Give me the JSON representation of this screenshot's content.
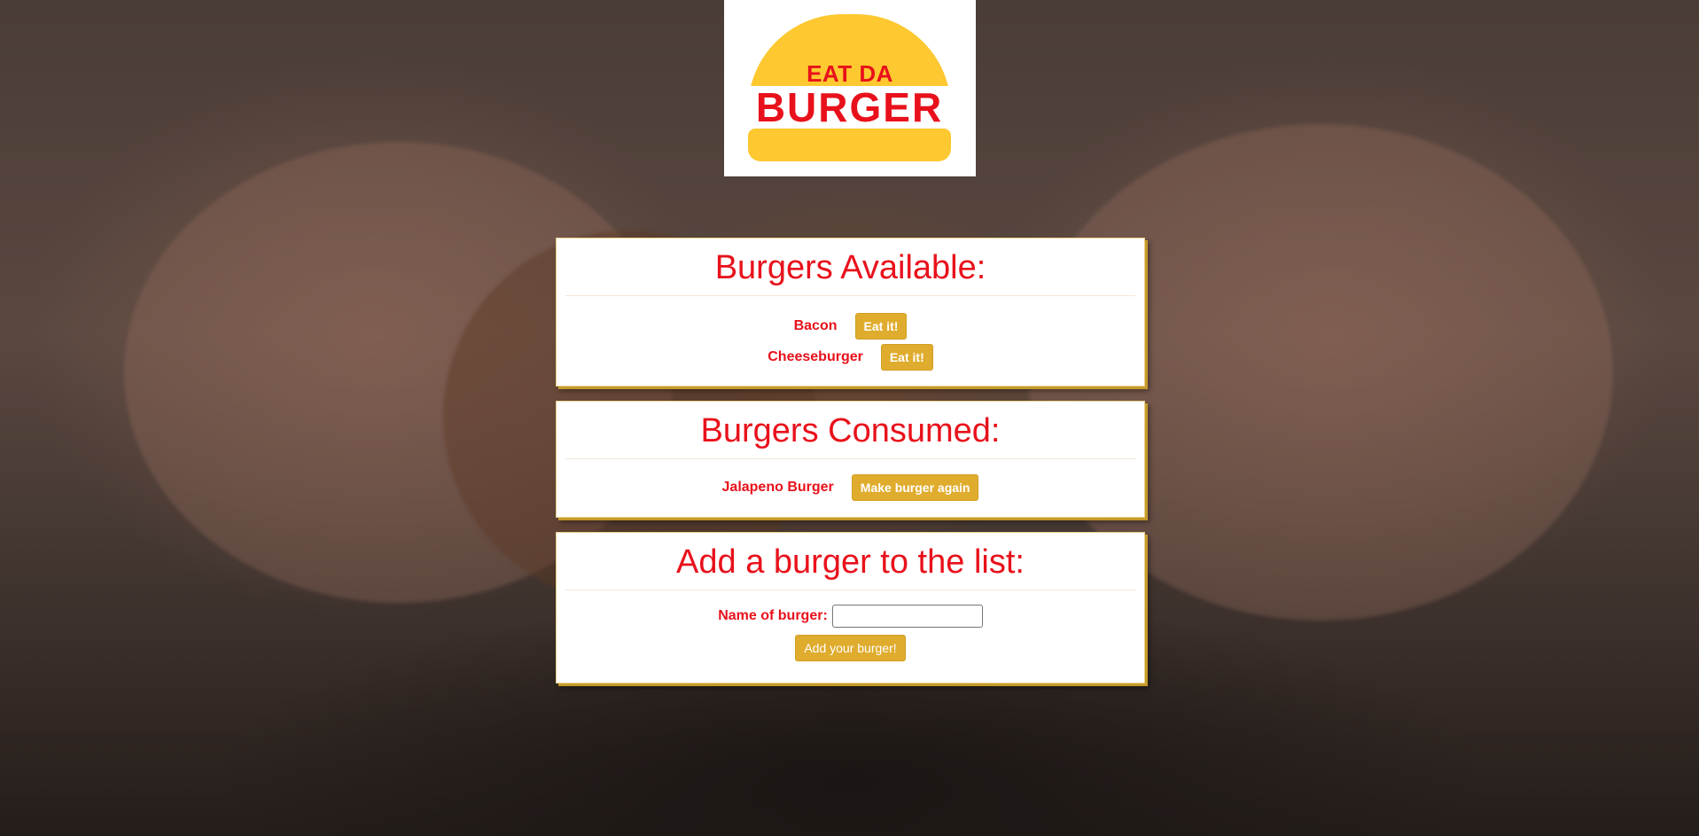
{
  "logo": {
    "line1": "EAT DA",
    "line2": "BURGER",
    "bun_color": "#fdc830",
    "text_color": "#e8111b"
  },
  "available": {
    "title": "Burgers Available:",
    "items": [
      {
        "name": "Bacon",
        "button": "Eat it!"
      },
      {
        "name": "Cheeseburger",
        "button": "Eat it!"
      }
    ]
  },
  "consumed": {
    "title": "Burgers Consumed:",
    "items": [
      {
        "name": "Jalapeno Burger",
        "button": "Make burger again"
      }
    ]
  },
  "add_form": {
    "title": "Add a burger to the list:",
    "label": "Name of burger:",
    "input_value": "",
    "submit": "Add your burger!"
  },
  "colors": {
    "accent_red": "#e8111b",
    "button_gold": "#e0ac2d",
    "card_shadow": "#c59a2a"
  }
}
